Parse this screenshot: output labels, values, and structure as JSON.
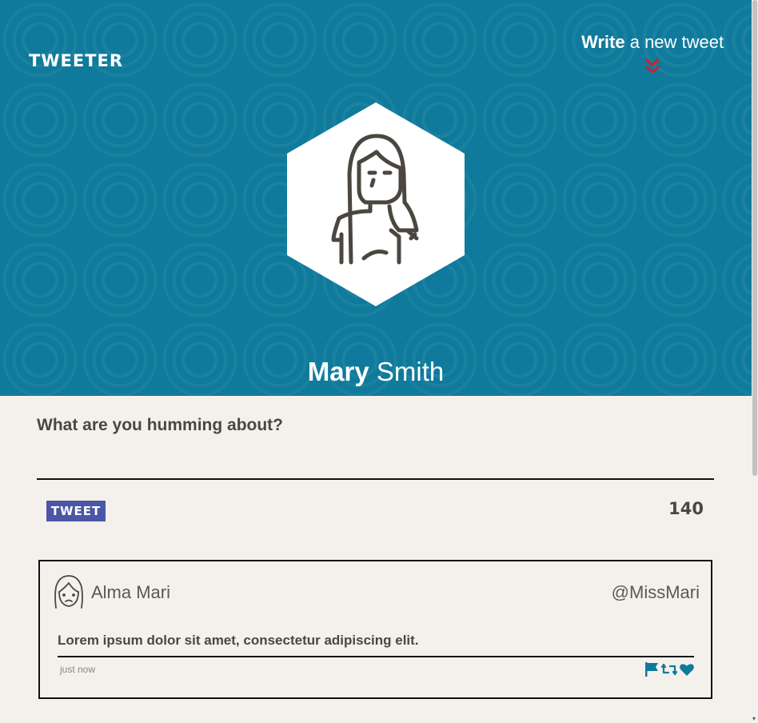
{
  "header": {
    "logo": "TWEETER",
    "compose_bold": "Write",
    "compose_rest": " a new tweet",
    "profile_first_name": "Mary",
    "profile_last_name": " Smith",
    "bg_color": "#0f7a9b",
    "accent_chevron_color": "#d0202a"
  },
  "composer": {
    "label": "What are you humming about?",
    "input_value": "",
    "button_label": "TWEET",
    "char_count": "140",
    "button_color": "#4c56a6"
  },
  "tweets": [
    {
      "author": "Alma Mari",
      "handle": "@MissMari",
      "text": "Lorem ipsum dolor sit amet, consectetur adipiscing elit.",
      "time": "just now",
      "actions": [
        "flag-icon",
        "retweet-icon",
        "heart-icon"
      ],
      "action_color": "#0f7a9b"
    }
  ]
}
